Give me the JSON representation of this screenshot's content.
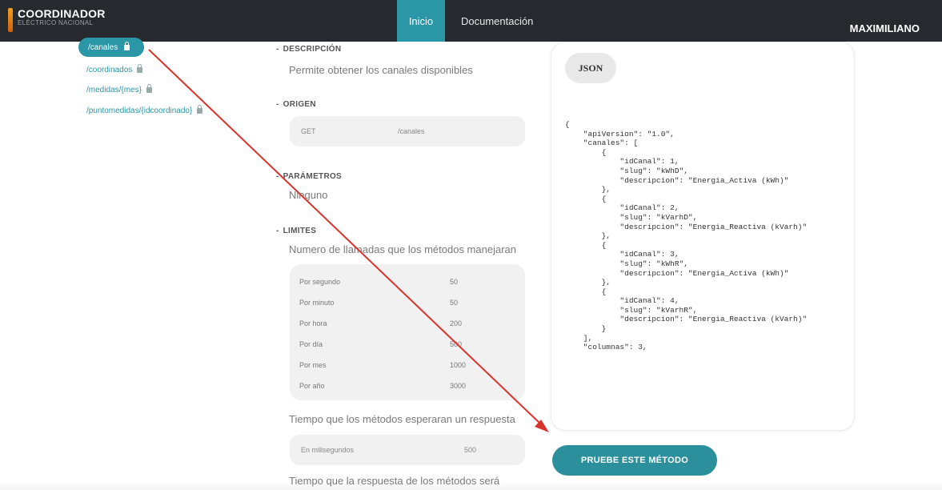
{
  "header": {
    "logo_main": "COORDINADOR",
    "logo_sub": "ELÉCTRICO NACIONAL",
    "nav": {
      "inicio": "Inicio",
      "docs": "Documentación"
    },
    "user": "MAXIMILIANO"
  },
  "sidebar": {
    "items": [
      {
        "label": "/canales"
      },
      {
        "label": "/coordinados"
      },
      {
        "label": "/medidas/{mes}"
      },
      {
        "label": "/puntomedidas/{idcoordinado}"
      }
    ]
  },
  "sections": {
    "descripcion": {
      "title": "DESCRIPCIÓN",
      "text": "Permite obtener los canales disponibles"
    },
    "origen": {
      "title": "ORIGEN",
      "method": "GET",
      "route": "/canales"
    },
    "parametros": {
      "title": "PARÁMETROS",
      "text": "Ninguno"
    },
    "limites": {
      "title": "LIMITES",
      "text": "Numero de llamadas que los métodos manejaran",
      "rows": [
        {
          "k": "Por segundo",
          "v": "50"
        },
        {
          "k": "Por minuto",
          "v": "50"
        },
        {
          "k": "Por hora",
          "v": "200"
        },
        {
          "k": "Por día",
          "v": "500"
        },
        {
          "k": "Por mes",
          "v": "1000"
        },
        {
          "k": "Por año",
          "v": "3000"
        }
      ],
      "wait_text": "Tiempo que los métodos esperaran un respuesta",
      "ms_label": "En milisegundos",
      "ms_value": "500",
      "resp_text": "Tiempo que la respuesta de los métodos será"
    }
  },
  "json_panel": {
    "pill": "JSON",
    "code": "{\n    \"apiVersion\": \"1.0\",\n    \"canales\": [\n        {\n            \"idCanal\": 1,\n            \"slug\": \"kWhD\",\n            \"descripcion\": \"Energia_Activa (kWh)\"\n        },\n        {\n            \"idCanal\": 2,\n            \"slug\": \"kVarhD\",\n            \"descripcion\": \"Energia_Reactiva (kVarh)\"\n        },\n        {\n            \"idCanal\": 3,\n            \"slug\": \"kWhR\",\n            \"descripcion\": \"Energia_Activa (kWh)\"\n        },\n        {\n            \"idCanal\": 4,\n            \"slug\": \"kVarhR\",\n            \"descripcion\": \"Energia_Reactiva (kVarh)\"\n        }\n    ],\n    \"columnas\": 3,"
  },
  "try_button": "PRUEBE ESTE MÉTODO",
  "colors": {
    "accent": "#2b97a6",
    "topbar": "#262a2f",
    "annotation": "#d9342b"
  }
}
